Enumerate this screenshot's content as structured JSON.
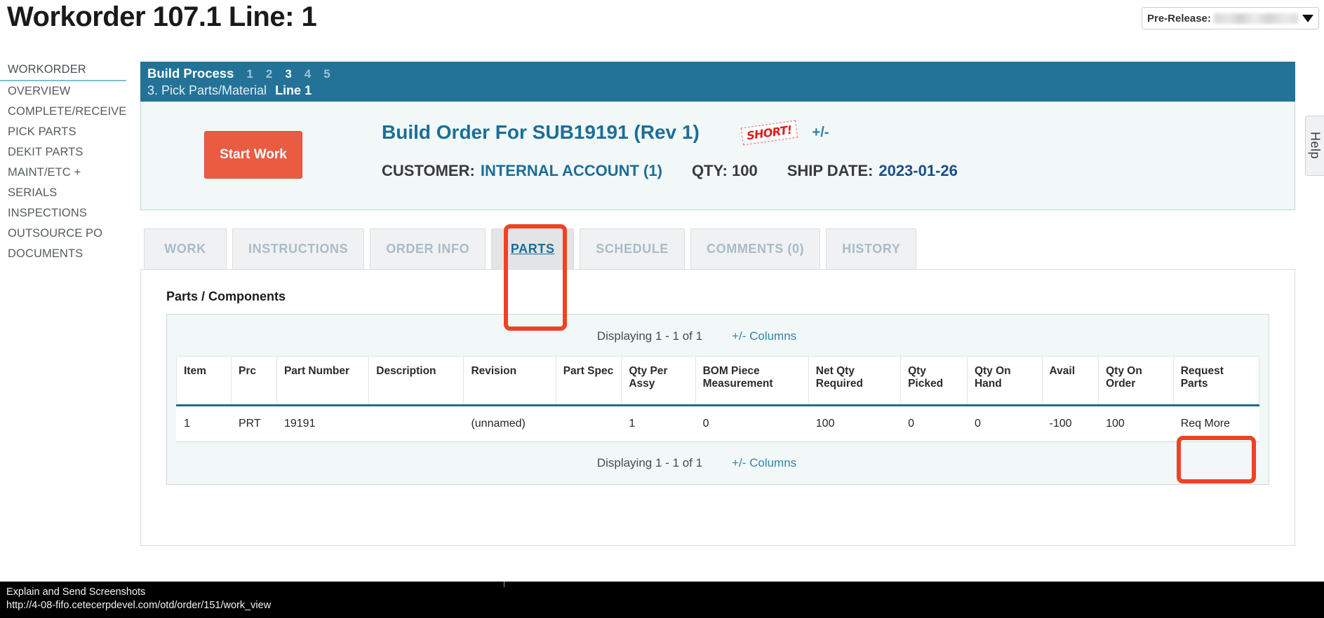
{
  "header": {
    "title": "Workorder 107.1 Line: 1",
    "prerelease": {
      "label": "Pre-Release:",
      "value": "",
      "caret_icon": "chevron-down-icon"
    }
  },
  "sidebar": {
    "items": [
      {
        "label": "WORKORDER"
      },
      {
        "label": "OVERVIEW"
      },
      {
        "label": "COMPLETE/RECEIVE"
      },
      {
        "label": "PICK PARTS"
      },
      {
        "label": "DEKIT PARTS"
      },
      {
        "label": "MAINT/ETC +"
      },
      {
        "label": "SERIALS"
      },
      {
        "label": "INSPECTIONS"
      },
      {
        "label": "OUTSOURCE PO"
      },
      {
        "label": "DOCUMENTS"
      }
    ]
  },
  "build_process": {
    "title": "Build Process",
    "steps": [
      "1",
      "2",
      "3",
      "4",
      "5"
    ],
    "active_step": "3",
    "subtitle": "3. Pick Parts/Material",
    "line": "Line 1"
  },
  "order": {
    "start_work_label": "Start Work",
    "title": "Build Order For SUB19191 (Rev 1)",
    "short_badge": "SHORT!",
    "plus_minus": "+/-",
    "customer_label": "CUSTOMER:",
    "customer_value": "INTERNAL ACCOUNT (1)",
    "qty": "QTY: 100",
    "ship_date_label": "SHIP DATE:",
    "ship_date_value": "2023-01-26"
  },
  "tabs": [
    {
      "label": "WORK",
      "active": false
    },
    {
      "label": "INSTRUCTIONS",
      "active": false
    },
    {
      "label": "ORDER INFO",
      "active": false
    },
    {
      "label": "PARTS",
      "active": true
    },
    {
      "label": "SCHEDULE",
      "active": false
    },
    {
      "label": "COMMENTS (0)",
      "active": false
    },
    {
      "label": "HISTORY",
      "active": false
    }
  ],
  "parts_panel": {
    "section_title": "Parts / Components",
    "displaying_top": "Displaying 1 - 1 of 1",
    "columns_link_top": "+/- Columns",
    "displaying_bottom": "Displaying 1 - 1 of 1",
    "columns_link_bottom": "+/- Columns",
    "columns": [
      "Item",
      "Prc",
      "Part Number",
      "Description",
      "Revision",
      "Part Spec",
      "Qty Per Assy",
      "BOM Piece Measurement",
      "Net Qty Required",
      "Qty Picked",
      "Qty On Hand",
      "Avail",
      "Qty On Order",
      "Request Parts"
    ],
    "rows": [
      {
        "item": "1",
        "prc": "PRT",
        "part_number": "19191",
        "description": "",
        "revision": "(unnamed)",
        "part_spec": "",
        "qty_per_assy": "1",
        "bom_piece_measurement": "0",
        "net_qty_required": "100",
        "qty_picked": "0",
        "qty_on_hand": "0",
        "avail": "-100",
        "qty_on_order": "100",
        "request_parts": "Req More"
      }
    ]
  },
  "help_tab": {
    "label": "Help"
  },
  "statusbar": {
    "line1": "Explain and Send Screenshots",
    "line2": "http://4-08-fifo.cetecerpdevel.com/otd/order/151/work_view"
  },
  "colors": {
    "accent_teal": "#237298",
    "link": "#2f86aa",
    "start_work": "#ea5c42",
    "annotation": "#ee4323",
    "short_red": "#e11b1b"
  }
}
